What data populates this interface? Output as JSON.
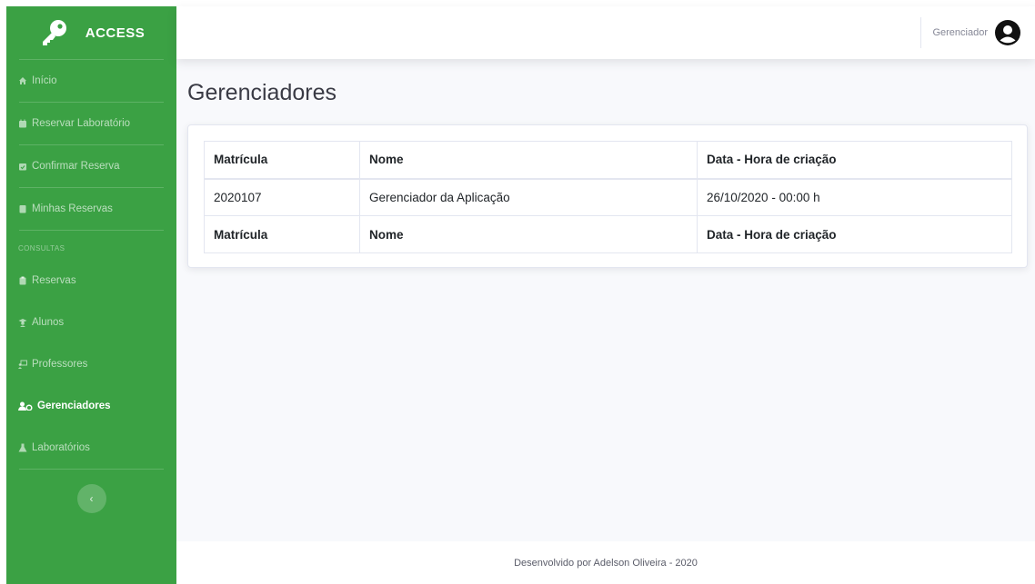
{
  "brand": {
    "name": "ACCESS",
    "icon": "key-icon"
  },
  "sidebar": {
    "items": [
      {
        "label": "Início",
        "icon": "home-icon"
      },
      {
        "label": "Reservar Laboratório",
        "icon": "calendar-icon"
      },
      {
        "label": "Confirmar Reserva",
        "icon": "calendar-check-icon"
      },
      {
        "label": "Minhas Reservas",
        "icon": "list-icon"
      }
    ],
    "section_heading": "CONSULTAS",
    "consultas": [
      {
        "label": "Reservas",
        "icon": "clipboard-icon"
      },
      {
        "label": "Alunos",
        "icon": "student-icon"
      },
      {
        "label": "Professores",
        "icon": "teacher-icon"
      },
      {
        "label": "Gerenciadores",
        "icon": "users-cog-icon",
        "active": true
      },
      {
        "label": "Laboratórios",
        "icon": "flask-icon"
      }
    ],
    "toggle_label": "‹"
  },
  "topbar": {
    "user_name": "Gerenciador"
  },
  "page": {
    "title": "Gerenciadores"
  },
  "table": {
    "headers": [
      "Matrícula",
      "Nome",
      "Data - Hora de criação"
    ],
    "rows": [
      [
        "2020107",
        "Gerenciador da Aplicação",
        "26/10/2020 - 00:00 h"
      ]
    ],
    "footers": [
      "Matrícula",
      "Nome",
      "Data - Hora de criação"
    ]
  },
  "footer": {
    "text": "Desenvolvido por Adelson Oliveira - 2020"
  },
  "colors": {
    "sidebar": "#3ba144",
    "background": "#f8f9fc"
  }
}
